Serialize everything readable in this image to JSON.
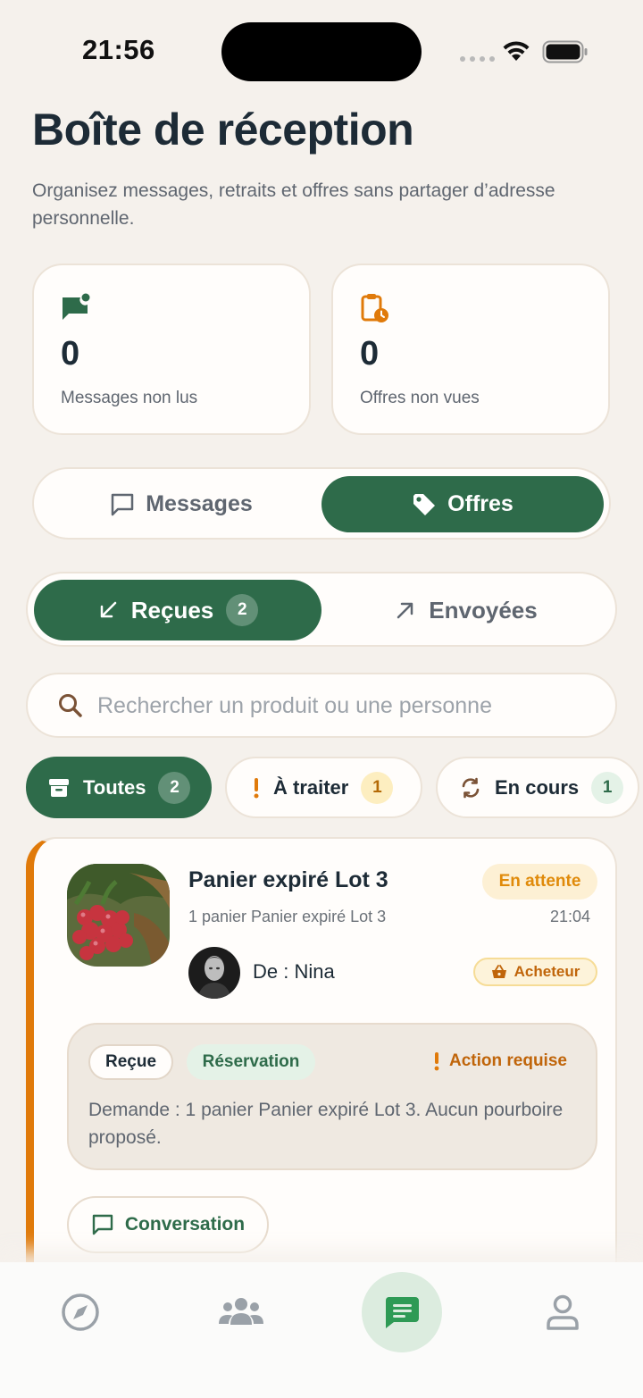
{
  "status_bar": {
    "time": "21:56"
  },
  "header": {
    "title": "Boîte de réception",
    "subtitle": "Organisez messages, retraits et offres sans partager d’adresse personnelle."
  },
  "stats": [
    {
      "value": "0",
      "label": "Messages non lus",
      "icon": "message-badge-icon"
    },
    {
      "value": "0",
      "label": "Offres non vues",
      "icon": "clipboard-clock-icon"
    }
  ],
  "main_tabs": {
    "messages": "Messages",
    "offers": "Offres",
    "active": "offers"
  },
  "direction_tabs": {
    "received": "Reçues",
    "received_count": "2",
    "sent": "Envoyées",
    "active": "received"
  },
  "search": {
    "placeholder": "Rechercher un produit ou une personne",
    "value": ""
  },
  "filters": [
    {
      "label": "Toutes",
      "count": "2",
      "active": true
    },
    {
      "label": "À traiter",
      "count": "1",
      "active": false
    },
    {
      "label": "En cours",
      "count": "1",
      "active": false
    }
  ],
  "offer_card": {
    "title": "Panier expiré Lot 3",
    "status": "En attente",
    "subtitle": "1 panier Panier expiré Lot 3",
    "time": "21:04",
    "from": "De : Nina",
    "role": "Acheteur",
    "tag_received": "Reçue",
    "tag_type": "Réservation",
    "action": "Action requise",
    "details": "Demande : 1 panier Panier expiré Lot 3. Aucun pourboire proposé.",
    "conversation_button": "Conversation"
  },
  "colors": {
    "background": "#f5f1ec",
    "primary": "#2e6b4a",
    "accent_orange": "#e07a0a",
    "pending": "#e08a0a"
  },
  "tabbar": [
    {
      "icon": "compass-icon",
      "active": false
    },
    {
      "icon": "people-icon",
      "active": false
    },
    {
      "icon": "chat-icon",
      "active": true
    },
    {
      "icon": "profile-icon",
      "active": false
    }
  ]
}
